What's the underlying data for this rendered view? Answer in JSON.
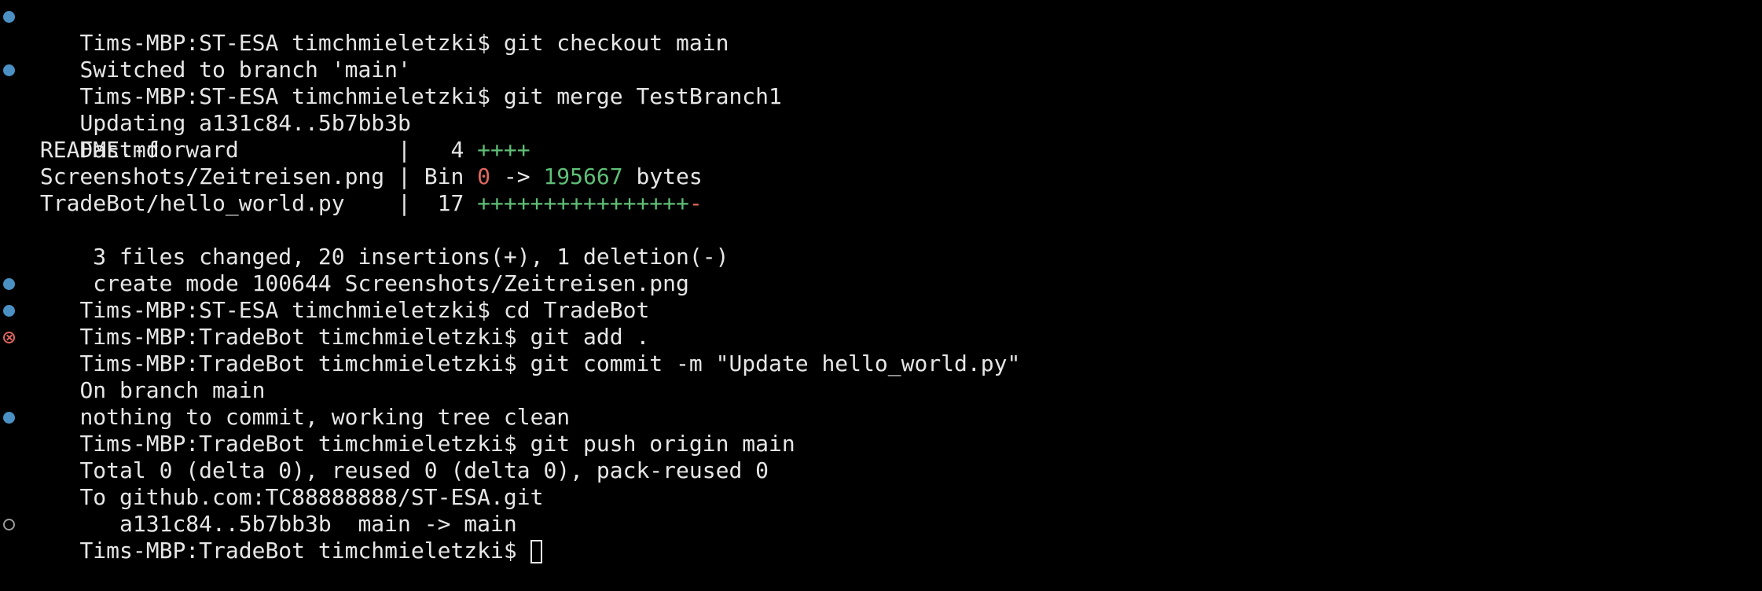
{
  "terminal": {
    "lines": [
      {
        "status": "ok",
        "text": "Tims-MBP:ST-ESA timchmieletzki$ git checkout main"
      },
      {
        "status": "",
        "text": "Switched to branch 'main'"
      },
      {
        "status": "ok",
        "text": "Tims-MBP:ST-ESA timchmieletzki$ git merge TestBranch1"
      },
      {
        "status": "",
        "text": "Updating a131c84..5b7bb3b"
      },
      {
        "status": "",
        "text": "Fast-forward"
      },
      {
        "status": "",
        "text": " README.md                  |   4 ",
        "plus": "++++"
      },
      {
        "status": "",
        "text": " Screenshots/Zeitreisen.png | Bin ",
        "old_bytes": "0",
        "arrow": " -> ",
        "new_bytes": "195667",
        "suffix": " bytes"
      },
      {
        "status": "",
        "text": " TradeBot/hello_world.py    |  17 ",
        "plus": "++++++++++++++++",
        "minus": "-"
      },
      {
        "status": "",
        "text": " 3 files changed, 20 insertions(+), 1 deletion(-)"
      },
      {
        "status": "",
        "text": " create mode 100644 Screenshots/Zeitreisen.png"
      },
      {
        "status": "ok",
        "text": "Tims-MBP:ST-ESA timchmieletzki$ cd TradeBot"
      },
      {
        "status": "ok",
        "text": "Tims-MBP:TradeBot timchmieletzki$ git add ."
      },
      {
        "status": "error",
        "text": "Tims-MBP:TradeBot timchmieletzki$ git commit -m \"Update hello_world.py\""
      },
      {
        "status": "",
        "text": "On branch main"
      },
      {
        "status": "",
        "text": "nothing to commit, working tree clean"
      },
      {
        "status": "ok",
        "text": "Tims-MBP:TradeBot timchmieletzki$ git push origin main"
      },
      {
        "status": "",
        "text": "Total 0 (delta 0), reused 0 (delta 0), pack-reused 0"
      },
      {
        "status": "",
        "text": "To github.com:TC88888888/ST-ESA.git"
      },
      {
        "status": "",
        "text": "   a131c84..5b7bb3b  main -> main"
      },
      {
        "status": "pending",
        "text": "Tims-MBP:TradeBot timchmieletzki$ "
      }
    ],
    "colors": {
      "background": "#000000",
      "foreground": "#e6e6e6",
      "success_marker": "#4a90c4",
      "error_marker": "#e0675f",
      "pending_marker": "#9a9a9a",
      "insertion": "#5fbf77",
      "deletion": "#e0675f"
    }
  }
}
